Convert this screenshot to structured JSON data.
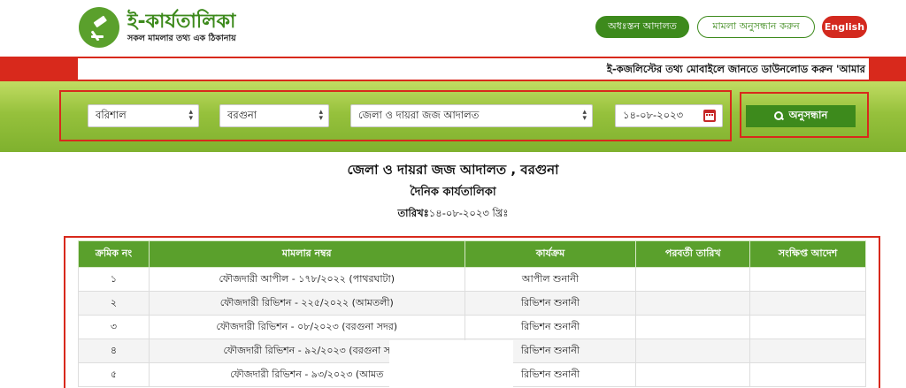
{
  "header": {
    "logo_title": "ই-কার্যতালিকা",
    "logo_tagline": "সকল মামলার তথ্য এক ঠিকানায়",
    "logo_icon": "gavel-icon",
    "nav": {
      "lower_court": "অধঃস্তন আদালত",
      "case_search": "মামলা অনুসন্ধান করুন",
      "english": "English"
    }
  },
  "marquee": {
    "text": "ই-কজলিস্টের তথ্য মোবাইলে জানতে ডাউনলোড করুন 'আমার"
  },
  "filters": {
    "division": "বরিশাল",
    "district": "বরগুনা",
    "court": "জেলা ও দায়রা জজ আদালত",
    "date": "১৪-০৮-২০২৩",
    "search_button": "অনুসন্ধান"
  },
  "content": {
    "court_title": "জেলা ও দায়রা জজ আদালত , বরগুনা",
    "list_title": "দৈনিক কার্যতালিকা",
    "date_label": "তারিখঃ",
    "date_value": "১৪-০৮-২০২৩ খ্রিঃ"
  },
  "table": {
    "headers": [
      "ক্রমিক নং",
      "মামলার নম্বর",
      "কার্যক্রম",
      "পরবর্তী তারিখ",
      "সংক্ষিপ্ত আদেশ"
    ],
    "rows": [
      {
        "sl": "১",
        "case": "ফৌজদারী আপীল - ১৭৮/২০২২ (পাথরঘাটা)",
        "action": "আপীল শুনানী",
        "next_date": "",
        "order": ""
      },
      {
        "sl": "২",
        "case": "ফৌজদারী রিভিশন - ২২৫/২০২২ (আমতলী)",
        "action": "রিভিশন শুনানী",
        "next_date": "",
        "order": ""
      },
      {
        "sl": "৩",
        "case": "ফৌজদারী রিভিশন - ০৮/২০২৩ (বরগুনা সদর)",
        "action": "রিভিশন শুনানী",
        "next_date": "",
        "order": ""
      },
      {
        "sl": "৪",
        "case": "ফৌজদারী রিভিশন - ৯২/২০২৩ (বরগুনা স",
        "action": "রিভিশন শুনানী",
        "next_date": "",
        "order": ""
      },
      {
        "sl": "৫",
        "case": "ফৌজদারী রিভিশন - ৯৩/২০২৩ (আমত",
        "action": "রিভিশন শুনানী",
        "next_date": "",
        "order": ""
      }
    ]
  },
  "colors": {
    "brand_green": "#3d8a1c",
    "header_green": "#5aa02c",
    "accent_red": "#d8291c"
  }
}
